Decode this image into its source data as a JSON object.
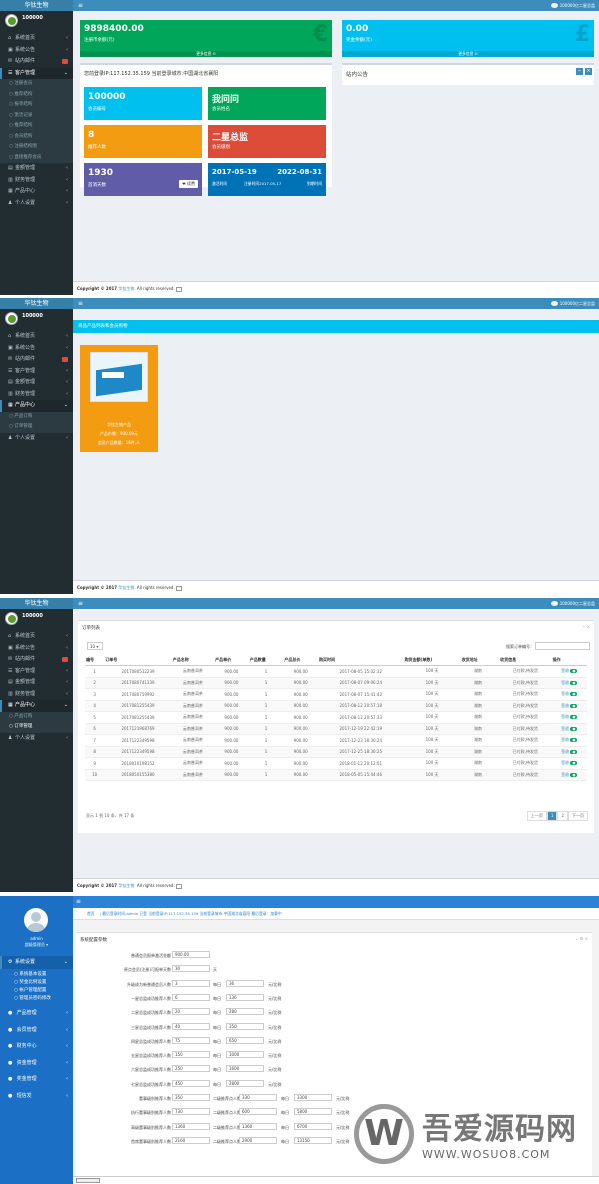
{
  "brand": "华钛生物",
  "username": "100000",
  "top_user": "100000亿二星总监",
  "footer": {
    "prefix": "Copyright © 2017",
    "link": "华钛生物.",
    "suffix": "All rights reserved."
  },
  "shot1": {
    "menu": [
      {
        "icon": "home-icon",
        "label": "系统首页"
      },
      {
        "icon": "bullhorn-icon",
        "label": "系统公告"
      },
      {
        "icon": "comment-icon",
        "label": "站内邮件"
      },
      {
        "icon": "users-icon",
        "label": "客户管理",
        "active": true
      }
    ],
    "submenu": [
      "注册会员",
      "推荐结构",
      "报单结构",
      "激活记录",
      "推荐结构",
      "会员结构",
      "注册结构图",
      "直接推荐会员"
    ],
    "menu2": [
      {
        "icon": "money-icon",
        "label": "金额管理"
      },
      {
        "icon": "chart-icon",
        "label": "财务管理"
      },
      {
        "icon": "cart-icon",
        "label": "产品中心"
      },
      {
        "icon": "user-icon",
        "label": "个人设置"
      }
    ],
    "box1": {
      "value": "9898400.00",
      "label": "注册币余额(元)",
      "more": "更多信息 ⊙"
    },
    "box2": {
      "value": "0.00",
      "label": "奖金余额(元)",
      "more": "更多信息 ⊙"
    },
    "login_info": "您前登录IP:117.152.35.159 当前登录城市:中国湖北省襄阳",
    "notice_title": "站内公告",
    "tiles": [
      {
        "n": "100000",
        "t": "会员编号"
      },
      {
        "n": "我问问",
        "t": "会员姓名"
      },
      {
        "n": "8",
        "t": "推荐人数"
      },
      {
        "n": "二星总监",
        "t": "会员级别"
      },
      {
        "n": "1930",
        "t": "首消天数"
      }
    ],
    "tile_btn": "✚ 续费",
    "date1": "2017-05-19",
    "date1_lbl": "激活时间",
    "date2": "2022-08-31",
    "date2_lbl": "到期时间",
    "reg_lbl": "注册时间2017-05-17"
  },
  "shot2": {
    "menu": [
      {
        "icon": "home-icon",
        "label": "系统首页"
      },
      {
        "icon": "bullhorn-icon",
        "label": "系统公告"
      },
      {
        "icon": "comment-icon",
        "label": "站内邮件"
      },
      {
        "icon": "users-icon",
        "label": "客户管理"
      },
      {
        "icon": "money-icon",
        "label": "金额管理"
      },
      {
        "icon": "chart-icon",
        "label": "财务管理"
      },
      {
        "icon": "cart-icon",
        "label": "产品中心",
        "active": true
      }
    ],
    "submenu": [
      "产品订购",
      "订单管理"
    ],
    "menu2": [
      {
        "icon": "user-icon",
        "label": "个人设置"
      }
    ],
    "banner": "商品产品列表和会员购物",
    "product": {
      "name": "华钛生物产品",
      "price": "产品价格：900.00元",
      "stock": "会员产品数量：16件,人"
    }
  },
  "shot3": {
    "panel_title": "订单列表",
    "page_size": "10",
    "search_label": "搜索订单编号：",
    "columns": [
      "编号",
      "订单号",
      "产品名称",
      "产品单价",
      "产品数量",
      "产品总价",
      "购买时间",
      "购货金额(单数)",
      "收货地址",
      "",
      "收货信息",
      "操作"
    ],
    "rows": [
      [
        "1",
        "2017080512239",
        "云南普洱茶",
        "900.00",
        "1",
        "900.00",
        "2017-08-05 15:02:32",
        "100 天",
        "湖南",
        "",
        "已付款,待发货",
        "签收"
      ],
      [
        "2",
        "2017080741339",
        "云南普洱茶",
        "900.00",
        "1",
        "900.00",
        "2017-08-07 09:06:24",
        "100 天",
        "湖南",
        "",
        "已付款,待发货",
        "签收"
      ],
      [
        "3",
        "2017080759992",
        "云南普洱茶",
        "900.00",
        "1",
        "900.00",
        "2017-08-07 15:41:42",
        "100 天",
        "湖南",
        "",
        "已付款,待发货",
        "签收"
      ],
      [
        "4",
        "2017081255439",
        "云南普洱茶",
        "900.00",
        "1",
        "900.00",
        "2017-08-12 20:57:18",
        "100 天",
        "湖南",
        "",
        "已付款,待发货",
        "签收"
      ],
      [
        "5",
        "2017081255439",
        "云南普洱茶",
        "900.00",
        "1",
        "900.00",
        "2017-08-12 20:57:33",
        "100 天",
        "湖南",
        "",
        "已付款,待发货",
        "签收"
      ],
      [
        "6",
        "2017121968769",
        "云南普洱茶",
        "900.00",
        "1",
        "900.00",
        "2017-12-19 22:42:19",
        "100 天",
        "湖南",
        "",
        "已付款,待发货",
        "签收"
      ],
      [
        "7",
        "2017122349598",
        "云南普洱茶",
        "900.00",
        "1",
        "900.00",
        "2017-12-23 18:30:24",
        "100 天",
        "湖南",
        "",
        "已付款,待发货",
        "签收"
      ],
      [
        "8",
        "2017122349598",
        "云南普洱茶",
        "900.00",
        "1",
        "900.00",
        "2017-12-25 18:30:25",
        "100 天",
        "湖南",
        "",
        "已付款,待发货",
        "签收"
      ],
      [
        "9",
        "2018010198152",
        "云南普洱茶",
        "900.00",
        "1",
        "900.00",
        "2018-01-12 20:12:01",
        "100 天",
        "湖南",
        "",
        "已付款,待发货",
        "签收"
      ],
      [
        "10",
        "2018050155380",
        "云南普洱茶",
        "900.00",
        "1",
        "900.00",
        "2018-05-05 15:44:46",
        "100 天",
        "湖南",
        "",
        "已付款,待发货",
        "签收"
      ]
    ],
    "info": "显示 1 到 10 条，共 17 条",
    "pager": [
      "上一页",
      "1",
      "2",
      "下一页"
    ]
  },
  "shot4": {
    "user_name": "admin",
    "user_role": "超级管理员",
    "crumb_home": "首页",
    "crumb_text": "|  最后登录时间:admin 已登 当前登录IP:117.152.35.159 当前登录城市:中国湖北省襄阳  最后登录：加载中",
    "menu_active": "系统设置",
    "submenu": [
      "系统基本设置",
      "奖金比例设置",
      "帐户管理配置",
      "管理员密码修改"
    ],
    "menu": [
      "产品管理",
      "会员管理",
      "财务中心",
      "资金管理",
      "奖金管理",
      "短信发"
    ],
    "panel_title": "系统配置参数",
    "fields": [
      {
        "label": "普通会员报单激活金额",
        "v": "900.00"
      },
      {
        "label": "原点会员(注册)可报单天数",
        "v": "30",
        "unit": "天"
      },
      {
        "label": "升级成为新普通会员人数",
        "v": "3",
        "p": "每日",
        "v2": "36",
        "u2": "元/比例"
      },
      {
        "label": "一星总监成功推荐人数",
        "v": "6",
        "p": "每日",
        "v2": "136",
        "u2": "元/比例"
      },
      {
        "label": "二星总监成功推荐人数",
        "v": "20",
        "p": "每日",
        "v2": "280",
        "u2": "元/比例"
      },
      {
        "label": "三星总监成功推荐人数",
        "v": "40",
        "p": "每日",
        "v2": "350",
        "u2": "元/比例"
      },
      {
        "label": "四星总监成功推荐人数",
        "v": "75",
        "p": "每日",
        "v2": "650",
        "u2": "元/比例"
      },
      {
        "label": "五星总监成功推荐人数",
        "v": "150",
        "p": "每日",
        "v2": "1000",
        "u2": "元/比例"
      },
      {
        "label": "六星总监成功推荐人数",
        "v": "250",
        "p": "每日",
        "v2": "1600",
        "u2": "元/比例"
      },
      {
        "label": "七星总监成功推荐人数",
        "v": "450",
        "p": "每日",
        "v2": "2800",
        "u2": "元/比例"
      },
      {
        "label": "董事级别推荐人数",
        "v": "350",
        "p": "二级推荐点人数",
        "v2": "330",
        "p3": "每日",
        "v3": "3300",
        "u3": "元/比例"
      },
      {
        "label": "执行董事级别推荐人数",
        "v": "730",
        "p": "二级推荐点人数",
        "v2": "600",
        "p3": "每日",
        "v3": "5800",
        "u3": "元/比例"
      },
      {
        "label": "高级董事级别推荐人数",
        "v": "1360",
        "p": "二级推荐点人数",
        "v2": "1360",
        "p3": "每日",
        "v3": "6700",
        "u3": "元/比例"
      },
      {
        "label": "首席董事级别推荐人数",
        "v": "2160",
        "p": "二级推荐点人数",
        "v2": "2900",
        "p3": "每日",
        "v3": "13150",
        "u3": "元/比例"
      }
    ],
    "watermark_cn": "吾爱源码网",
    "watermark_url": "WWW.WOSUO8.COM"
  }
}
